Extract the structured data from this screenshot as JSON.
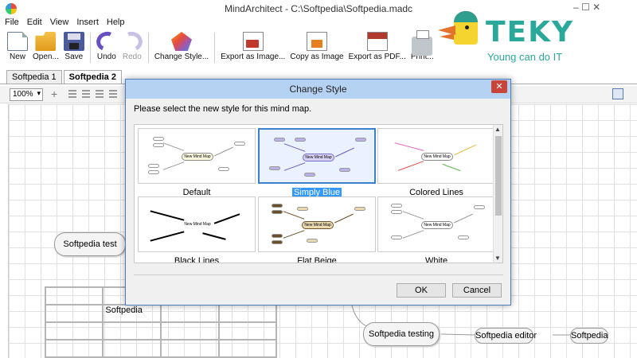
{
  "window": {
    "title": "MindArchitect - C:\\Softpedia\\Softpedia.madc"
  },
  "menu": [
    "File",
    "Edit",
    "View",
    "Insert",
    "Help"
  ],
  "toolbar": [
    {
      "label": "New",
      "icon": "new-file-icon"
    },
    {
      "label": "Open...",
      "icon": "open-folder-icon"
    },
    {
      "label": "Save",
      "icon": "save-disk-icon"
    },
    {
      "label": "Undo",
      "icon": "undo-icon"
    },
    {
      "label": "Redo",
      "icon": "redo-icon",
      "disabled": true
    },
    {
      "label": "Change Style...",
      "icon": "style-icon"
    },
    {
      "label": "Export as Image...",
      "icon": "export-image-icon"
    },
    {
      "label": "Copy as Image",
      "icon": "copy-image-icon"
    },
    {
      "label": "Export as PDF...",
      "icon": "export-pdf-icon"
    },
    {
      "label": "Print...",
      "icon": "printer-icon"
    }
  ],
  "tabs": [
    {
      "label": "Softpedia 1",
      "active": false
    },
    {
      "label": "Softpedia 2",
      "active": true
    }
  ],
  "formatbar": {
    "zoom": "100%"
  },
  "canvas": {
    "nodes": {
      "left_node": "Softpedia test",
      "center_node": "Softpedia testing",
      "editor_node": "Softpedia editor",
      "right_node": "Softpedia"
    },
    "table_cell": "Softpedia"
  },
  "dialog": {
    "title": "Change Style",
    "prompt": "Please select the new style for this mind map.",
    "styles": [
      {
        "name": "Default",
        "selected": false
      },
      {
        "name": "Simply Blue",
        "selected": true
      },
      {
        "name": "Colored Lines",
        "selected": false
      },
      {
        "name": "Black Lines",
        "selected": false
      },
      {
        "name": "Flat Beige",
        "selected": false
      },
      {
        "name": "White",
        "selected": false
      }
    ],
    "thumb_center_label": "New Mind Map",
    "ok_label": "OK",
    "cancel_label": "Cancel",
    "close_glyph": "✕"
  },
  "watermark": {
    "brand": "TEKY",
    "tagline": "Young can do IT",
    "win_controls": "–  ☐  ✕"
  },
  "colors": {
    "selection": "#3399ff",
    "dialog_title": "#b6d2f3",
    "close_button": "#c9443a",
    "brand": "#2aa89a"
  }
}
